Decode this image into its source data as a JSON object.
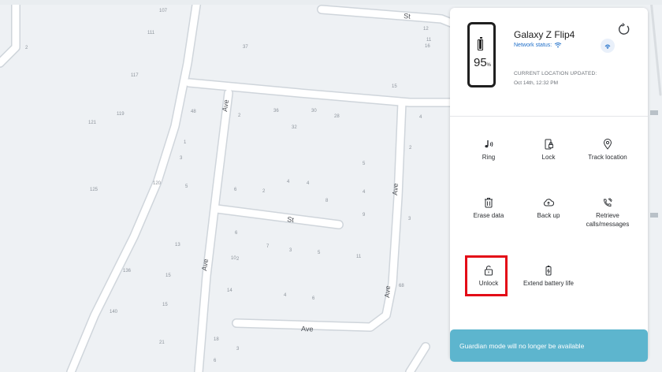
{
  "map": {
    "street_labels": [
      "St",
      "Ave",
      "Ave",
      "St",
      "Ave",
      "Ave",
      "Ave"
    ],
    "lot_numbers": [
      "107",
      "111",
      "2",
      "37",
      "12",
      "11",
      "117",
      "16",
      "15",
      "48",
      "36",
      "30",
      "28",
      "121",
      "119",
      "32",
      "2",
      "1",
      "3",
      "125",
      "120",
      "5",
      "4",
      "6",
      "2",
      "4",
      "8",
      "9",
      "5",
      "4",
      "13",
      "6",
      "2",
      "3",
      "7",
      "11",
      "10",
      "15",
      "5",
      "136",
      "14",
      "4",
      "6",
      "68",
      "140",
      "15",
      "18",
      "21",
      "3",
      "6",
      "4",
      "2",
      "3"
    ]
  },
  "device": {
    "name": "Galaxy Z Flip4",
    "battery_value": "95",
    "battery_unit": "%",
    "battery_level": 0.95,
    "network_label": "Network status:",
    "location_label": "CURRENT LOCATION UPDATED:",
    "location_time": "Oct 14th, 12:32 PM"
  },
  "actions": {
    "ring": "Ring",
    "lock": "Lock",
    "track_location": "Track location",
    "erase_data": "Erase data",
    "back_up": "Back up",
    "retrieve_calls": "Retrieve calls/messages",
    "unlock": "Unlock",
    "extend_battery": "Extend battery life"
  },
  "toast": {
    "message": "Guardian mode will no longer be available"
  },
  "colors": {
    "accent_blue": "#1f6fc9",
    "highlight_red": "#e30b17",
    "toast_bg": "#5db5ce"
  }
}
